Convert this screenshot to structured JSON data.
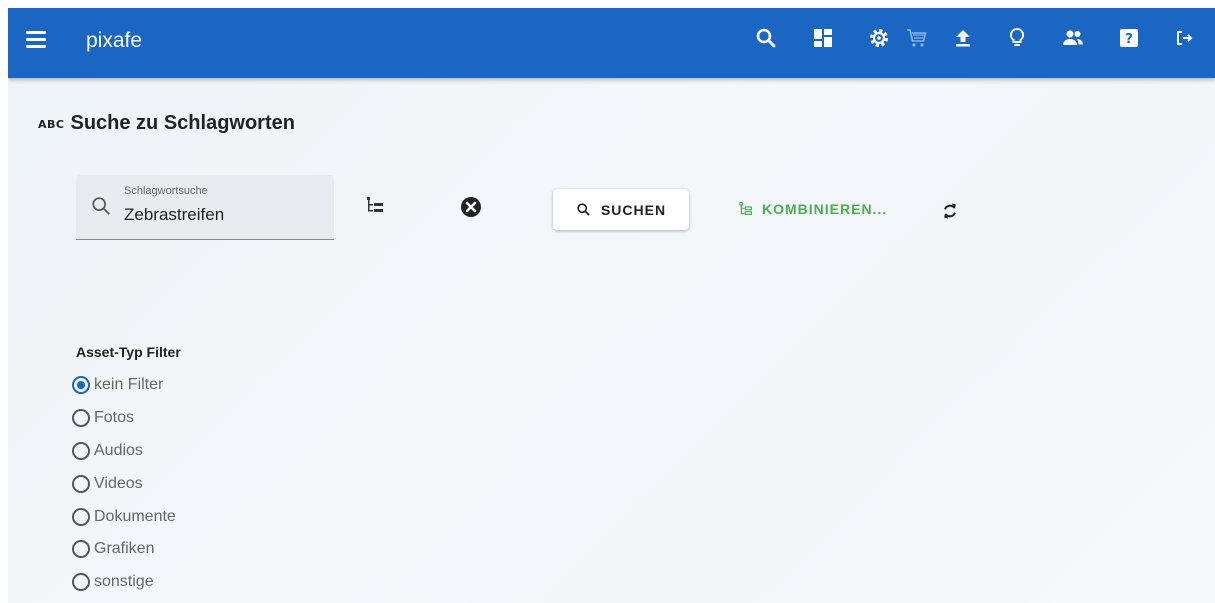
{
  "app": {
    "brand": "pixafe",
    "accent": "#1a66c2",
    "success": "#4caf50"
  },
  "toolbar_icons": [
    "search-icon",
    "dashboard-icon",
    "settings-icon",
    "cart-icon",
    "upload-icon",
    "lightbulb-icon",
    "users-icon",
    "help-icon",
    "logout-icon"
  ],
  "page": {
    "title_prefix": "ABC",
    "title": "Suche zu Schlagworten"
  },
  "search": {
    "label": "Schlagwortsuche",
    "value": "Zebrastreifen"
  },
  "actions": {
    "search_label": "SUCHEN",
    "combine_label": "KOMBINIEREN..."
  },
  "filter": {
    "title": "Asset-Typ Filter",
    "selected": "kein Filter",
    "options": [
      "kein Filter",
      "Fotos",
      "Audios",
      "Videos",
      "Dokumente",
      "Grafiken",
      "sonstige"
    ]
  }
}
